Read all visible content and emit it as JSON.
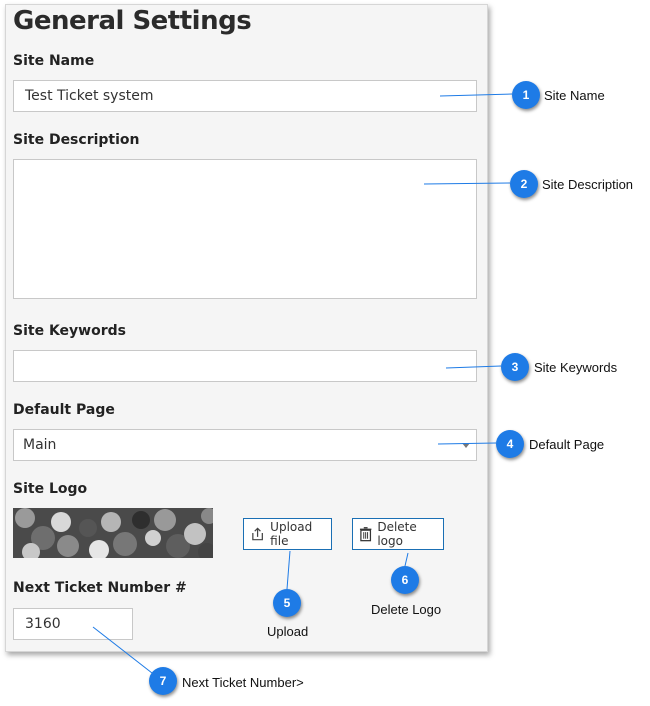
{
  "page_title": "General Settings",
  "site_name": {
    "label": "Site Name",
    "value": "Test Ticket system"
  },
  "site_description": {
    "label": "Site Description",
    "value": ""
  },
  "site_keywords": {
    "label": "Site Keywords",
    "value": ""
  },
  "default_page": {
    "label": "Default Page",
    "selected": "Main"
  },
  "site_logo": {
    "label": "Site Logo",
    "upload_label": "Upload file",
    "delete_label": "Delete logo"
  },
  "next_ticket": {
    "label": "Next Ticket Number #",
    "value": "3160"
  },
  "callouts": [
    {
      "number": "1",
      "text": "Site Name"
    },
    {
      "number": "2",
      "text": "Site Description"
    },
    {
      "number": "3",
      "text": "Site Keywords"
    },
    {
      "number": "4",
      "text": "Default Page"
    },
    {
      "number": "5",
      "text": "Upload"
    },
    {
      "number": "6",
      "text": "Delete Logo"
    },
    {
      "number": "7",
      "text": "Next Ticket Number>"
    }
  ],
  "colors": {
    "callout": "#1e7be6",
    "button_border": "#1a6fb4",
    "panel_bg": "#f5f5f5"
  }
}
